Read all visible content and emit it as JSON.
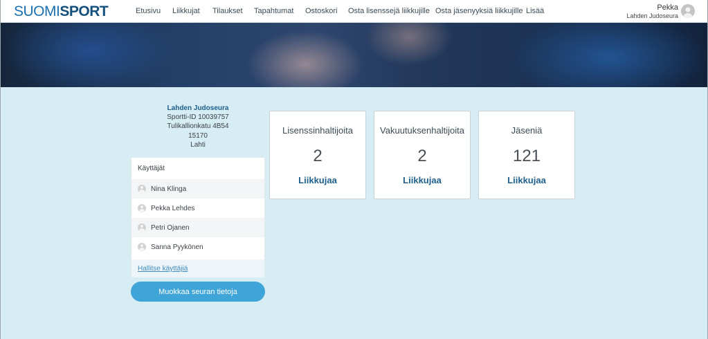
{
  "logo": {
    "part1": "SUOMI",
    "part2": "SPORT"
  },
  "nav": [
    {
      "label": "Etusivu"
    },
    {
      "label": "Liikkujat"
    },
    {
      "label": "Tilaukset"
    },
    {
      "label": "Tapahtumat"
    },
    {
      "label": "Ostoskori"
    },
    {
      "label": "Osta lisenssejä liikkujille"
    },
    {
      "label": "Osta jäsenyyksiä liikkujille"
    },
    {
      "label": "Lisää"
    }
  ],
  "user": {
    "name": "Pekka",
    "org": "Lahden Judoseura"
  },
  "club": {
    "name": "Lahden Judoseura",
    "sportti_id": "Sportti-ID 10039757",
    "street": "Tulikallionkatu 4B54",
    "postal": "15170",
    "city": "Lahti"
  },
  "users_panel": {
    "title": "Käyttäjät",
    "users": [
      {
        "name": "Nina Klinga"
      },
      {
        "name": "Pekka Lehdes"
      },
      {
        "name": "Petri Ojanen"
      },
      {
        "name": "Sanna Pyykönen"
      }
    ],
    "manage_link": "Hallitse käyttäjiä"
  },
  "edit_button": "Muokkaa seuran tietoja",
  "cards": [
    {
      "title": "Lisenssinhaltijoita",
      "value": "2",
      "link": "Liikkujaa"
    },
    {
      "title": "Vakuutuksenhaltijoita",
      "value": "2",
      "link": "Liikkujaa"
    },
    {
      "title": "Jäseniä",
      "value": "121",
      "link": "Liikkujaa"
    }
  ],
  "colors": {
    "accent": "#3fa4d7",
    "brand_dark": "#14507d",
    "background": "#d5edf3"
  }
}
